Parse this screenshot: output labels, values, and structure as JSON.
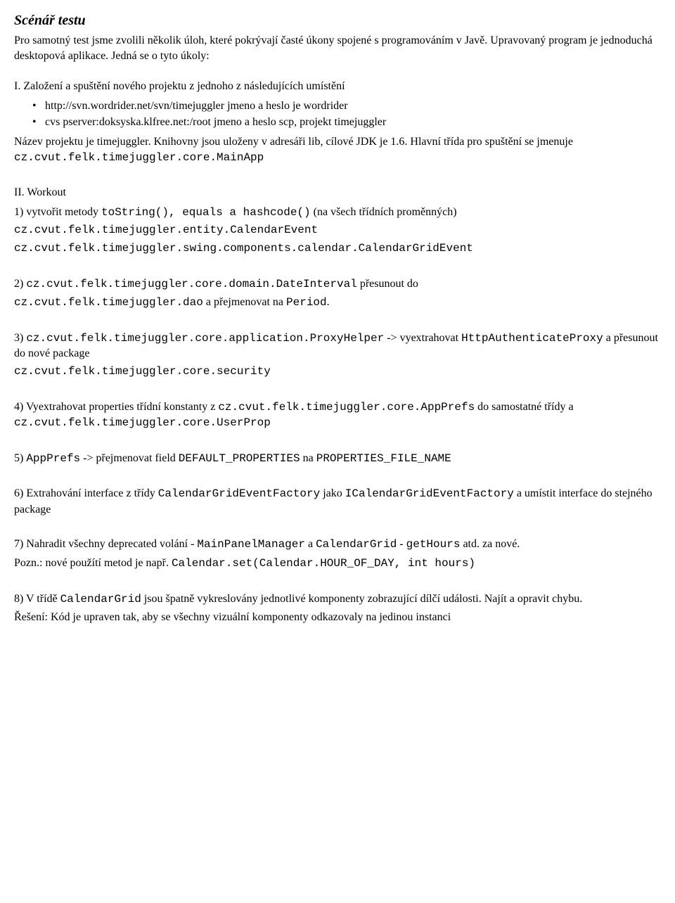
{
  "title": "Scénář testu",
  "intro": "Pro samotný test jsme zvolili několik úloh, které pokrývají časté úkony spojené s programováním v Javě. Upravovaný program je jednoduchá desktopová aplikace. Jedná se o tyto úkoly:",
  "section1": {
    "head": "I. Založení a spuštění nového projektu z jednoho z následujících umístění",
    "bullets": [
      "http://svn.wordrider.net/svn/timejuggler jmeno a heslo je wordrider",
      "cvs pserver:doksyska.klfree.net:/root jmeno a heslo scp, projekt timejuggler"
    ],
    "after_pre": "Název projektu je timejuggler. Knihovny jsou uloženy v adresáři lib, cílové JDK je 1.6. Hlavní třída pro spuštění se jmenuje ",
    "after_code": "cz.cvut.felk.timejuggler.core.MainApp"
  },
  "section2": {
    "head": "II. Workout",
    "item1": {
      "pre": "1) vytvořit metody ",
      "code1": "toString(), equals a hashcode()",
      "mid": " (na všech třídních proměnných)",
      "line2": "cz.cvut.felk.timejuggler.entity.CalendarEvent",
      "line3": "cz.cvut.felk.timejuggler.swing.components.calendar.CalendarGridEvent"
    },
    "item2": {
      "pre": "2) ",
      "code1": "cz.cvut.felk.timejuggler.core.domain.DateInterval",
      "mid": " přesunout do",
      "line2_code": "cz.cvut.felk.timejuggler.dao",
      "line2_mid": " a přejmenovat na ",
      "line2_code2": "Period",
      "line2_end": "."
    },
    "item3": {
      "pre": "3) ",
      "code1": "cz.cvut.felk.timejuggler.core.application.ProxyHelper",
      "mid1": " -> vyextrahovat ",
      "code2": "HttpAuthenticateProxy",
      "mid2": " a přesunout do nové package",
      "line2": "cz.cvut.felk.timejuggler.core.security"
    },
    "item4": {
      "pre": "4) Vyextrahovat properties třídní konstanty z ",
      "code1": "cz.cvut.felk.timejuggler.core.AppPrefs",
      "mid1": " do samostatné třídy a ",
      "code2": "cz.cvut.felk.timejuggler.core.UserProp"
    },
    "item5": {
      "pre": "5) ",
      "code1": "AppPrefs",
      "mid1": " -> přejmenovat field ",
      "code2": "DEFAULT_PROPERTIES",
      "mid2": " na ",
      "code3": "PROPERTIES_FILE_NAME"
    },
    "item6": {
      "pre": "6) Extrahování interface z třídy ",
      "code1": "CalendarGridEventFactory",
      "mid1": " jako ",
      "code2": "ICalendarGridEventFactory",
      "mid2": " a umístit interface do stejného package"
    },
    "item7": {
      "pre": "7) Nahradit všechny deprecated volání - ",
      "code1": "MainPanelManager",
      "mid1": " a ",
      "code2": "CalendarGrid",
      "mid2": " - ",
      "code3": "getHours",
      "mid3": " atd. za nové.",
      "note_pre": "Pozn.: nové použítí metod je např. ",
      "note_code": "Calendar.set(Calendar.HOUR_OF_DAY, int hours)"
    },
    "item8": {
      "pre": "8) V třídě ",
      "code1": "CalendarGrid",
      "mid1": " jsou špatně vykreslovány jednotlivé komponenty zobrazující dílčí události. Najít a opravit chybu.",
      "sol": "Řešení: Kód je upraven tak, aby se všechny vizuální komponenty odkazovaly na jedinou instanci"
    }
  }
}
